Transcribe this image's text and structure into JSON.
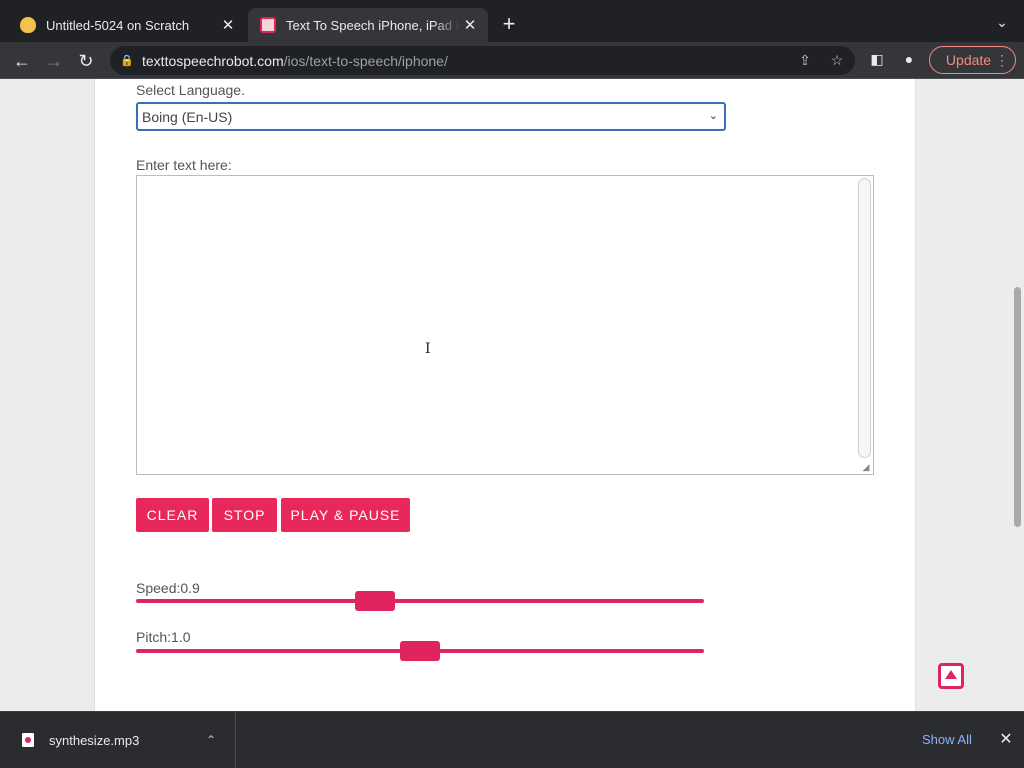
{
  "browser": {
    "tabs": [
      {
        "title": "Untitled-5024 on Scratch",
        "close": "✕"
      },
      {
        "title": "Text To Speech iPhone, iPad iOS",
        "close": "✕"
      }
    ],
    "new_tab": "+",
    "tab_menu": "⌄",
    "nav": {
      "back": "←",
      "forward": "→",
      "reload": "↻"
    },
    "url_host": "texttospeechrobot.com",
    "url_path": "/ios/text-to-speech/iphone/",
    "update_label": "Update",
    "menu_dots": "⋮"
  },
  "page": {
    "language_label": "Select Language.",
    "language_selected": "Boing (En-US)",
    "text_label": "Enter text here:",
    "text_value": "",
    "buttons": {
      "clear": "CLEAR",
      "stop": "STOP",
      "play_pause": "PLAY & PAUSE"
    },
    "speed": {
      "label": "Speed:0.9",
      "value": 0.9,
      "min": 0.1,
      "max": 2.0
    },
    "pitch": {
      "label": "Pitch:1.0",
      "value": 1.0,
      "min": 0.0,
      "max": 2.0
    },
    "accent_color": "#e0245e"
  },
  "downloads": {
    "file_name": "synthesize.mp3",
    "show_all": "Show All",
    "close": "✕"
  }
}
